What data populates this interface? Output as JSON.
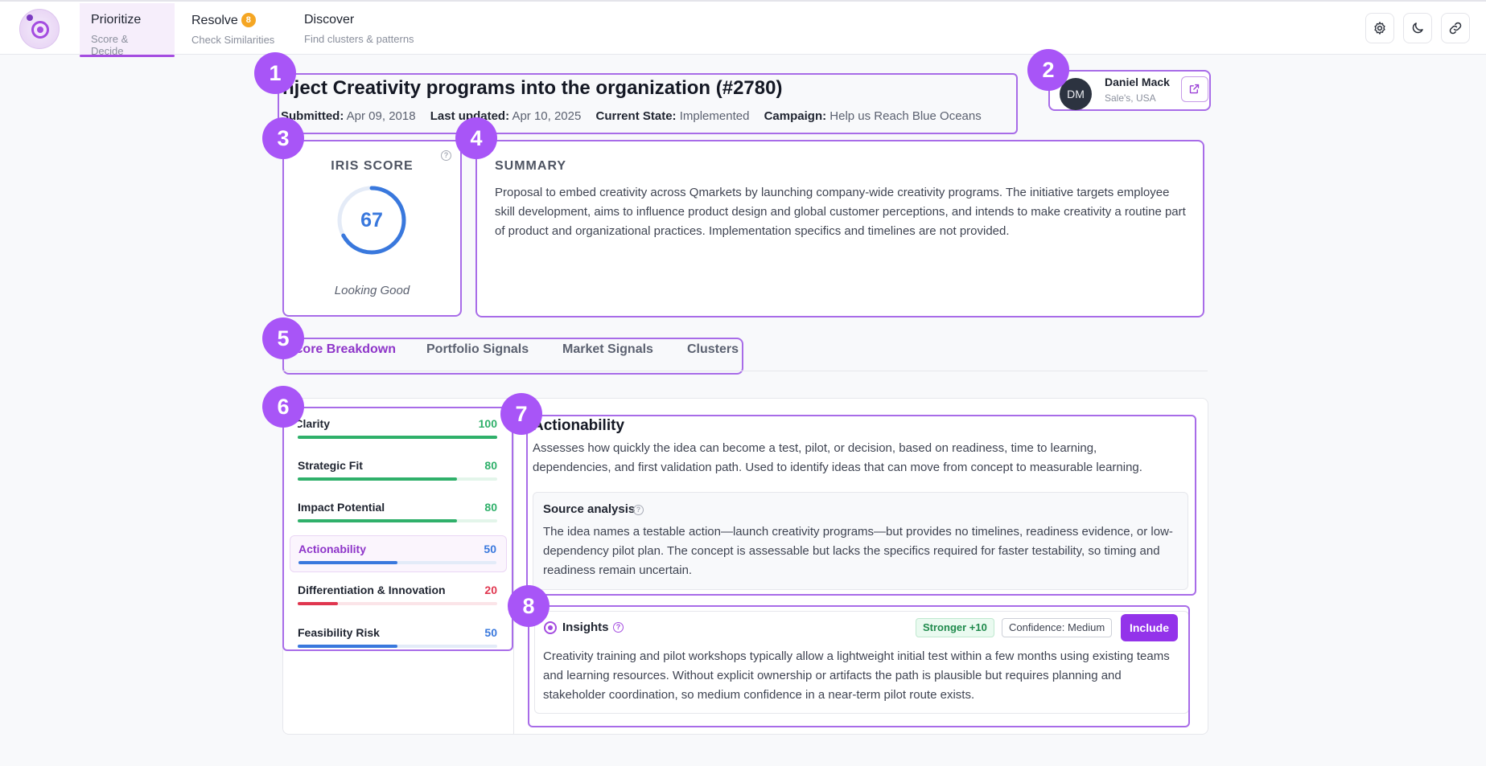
{
  "nav": {
    "tabs": [
      {
        "label": "Prioritize",
        "sublabel": "Score & Decide"
      },
      {
        "label": "Resolve",
        "sublabel": "Check Similarities",
        "badge": "8"
      },
      {
        "label": "Discover",
        "sublabel": "Find clusters & patterns"
      }
    ],
    "tools": [
      "gear-icon",
      "moon-icon",
      "link-icon"
    ]
  },
  "idea": {
    "title": "nject Creativity programs into the organization (#2780)",
    "submitted_label": "Submitted:",
    "submitted": "Apr 09, 2018",
    "updated_label": "Last updated:",
    "updated": "Apr 10, 2025",
    "state_label": "Current State:",
    "state": "Implemented",
    "campaign_label": "Campaign:",
    "campaign": "Help us Reach Blue Oceans"
  },
  "author": {
    "initials": "DM",
    "name": "Daniel Mack",
    "location": "Sale's, USA"
  },
  "iris": {
    "label": "IRIS SCORE",
    "value": 67,
    "status": "Looking Good",
    "accent": "#3978dd"
  },
  "summary": {
    "heading": "SUMMARY",
    "text": "Proposal to embed creativity across Qmarkets by launching company-wide creativity programs. The initiative targets employee skill development, aims to influence product design and global customer perceptions, and intends to make creativity a routine part of product and organizational practices. Implementation specifics and timelines are not provided."
  },
  "tabs": [
    {
      "label": "Score Breakdown"
    },
    {
      "label": "Portfolio Signals"
    },
    {
      "label": "Market Signals"
    },
    {
      "label": "Clusters"
    }
  ],
  "metrics": [
    {
      "name": "Clarity",
      "value": 100,
      "color": "#2fb06a",
      "track": "#e3f5ea"
    },
    {
      "name": "Strategic Fit",
      "value": 80,
      "color": "#2fb06a",
      "track": "#e3f5ea"
    },
    {
      "name": "Impact Potential",
      "value": 80,
      "color": "#2fb06a",
      "track": "#e3f5ea"
    },
    {
      "name": "Actionability",
      "value": 50,
      "color": "#3978dd",
      "track": "#e3ebf8"
    },
    {
      "name": "Differentiation & Innovation",
      "value": 20,
      "color": "#e0364f",
      "track": "#fbe4e8"
    },
    {
      "name": "Feasibility Risk",
      "value": 50,
      "color": "#3978dd",
      "track": "#e3ebf8"
    }
  ],
  "detail": {
    "title": "Actionability",
    "description": "Assesses how quickly the idea can become a test, pilot, or decision, based on readiness, time to learning, dependencies, and first validation path. Used to identify ideas that can move from concept to measurable learning.",
    "source_heading": "Source analysis",
    "source_text": "The idea names a testable action—launch creativity programs—but provides no timelines, readiness evidence, or low-dependency pilot plan. The concept is assessable but lacks the specifics required for faster testability, so timing and readiness remain uncertain."
  },
  "insights": {
    "heading": "Insights",
    "stronger": "Stronger +10",
    "confidence": "Confidence: Medium",
    "include_label": "Include",
    "text": "Creativity training and pilot workshops typically allow a lightweight initial test within a few months using existing teams and learning resources. Without explicit ownership or artifacts the path is plausible but requires planning and stakeholder coordination, so medium confidence in a near-term pilot route exists."
  },
  "markers": [
    "1",
    "2",
    "3",
    "4",
    "5",
    "6",
    "7",
    "8"
  ]
}
